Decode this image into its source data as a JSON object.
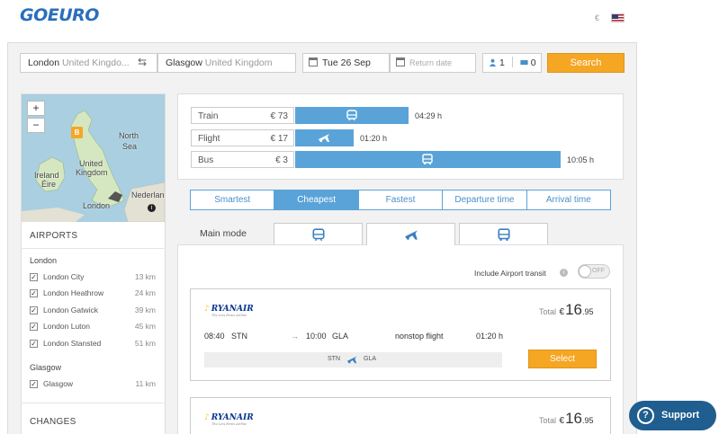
{
  "header": {
    "logo": "GOEURO",
    "currency": "€"
  },
  "search": {
    "from_city": "London",
    "from_country": "United Kingdo...",
    "to_city": "Glasgow",
    "to_country": "United Kingdom",
    "depart_date": "Tue 26 Sep",
    "return_placeholder": "Return date",
    "passengers": "1",
    "discount_cards": "0",
    "search_label": "Search"
  },
  "map": {
    "zoom_in": "+",
    "zoom_out": "−",
    "labels": [
      "North",
      "Sea",
      "United",
      "Kingdom",
      "Ireland",
      "Éire",
      "Nederland",
      "London"
    ],
    "pin_label": "B"
  },
  "sidebar": {
    "airports_title": "AIRPORTS",
    "groups": [
      {
        "name": "London",
        "airports": [
          {
            "name": "London City",
            "distance": "13 km",
            "checked": "✓"
          },
          {
            "name": "London Heathrow",
            "distance": "24 km",
            "checked": "✓"
          },
          {
            "name": "London Gatwick",
            "distance": "39 km",
            "checked": "✓"
          },
          {
            "name": "London Luton",
            "distance": "45 km",
            "checked": "✓"
          },
          {
            "name": "London Stansted",
            "distance": "51 km",
            "checked": "✓"
          }
        ]
      },
      {
        "name": "Glasgow",
        "airports": [
          {
            "name": "Glasgow",
            "distance": "11 km",
            "checked": "✓"
          }
        ]
      }
    ],
    "changes_title": "CHANGES"
  },
  "summary": {
    "modes": [
      {
        "name": "Train",
        "price": "€ 73",
        "duration": "04:29 h",
        "icon": "train-icon",
        "relative_length": 0.25
      },
      {
        "name": "Flight",
        "price": "€ 17",
        "duration": "01:20 h",
        "icon": "plane-icon",
        "relative_length": 0.13
      },
      {
        "name": "Bus",
        "price": "€ 3",
        "duration": "10:05 h",
        "icon": "bus-icon",
        "relative_length": 1.0
      }
    ],
    "bar_color": "#5aa3d8"
  },
  "sort_tabs": [
    {
      "label": "Smartest",
      "active": false
    },
    {
      "label": "Cheapest",
      "active": true
    },
    {
      "label": "Fastest",
      "active": false
    },
    {
      "label": "Departure time",
      "active": false
    },
    {
      "label": "Arrival time",
      "active": false
    }
  ],
  "main_mode": {
    "label": "Main mode",
    "tabs": [
      {
        "icon": "train-icon",
        "active": false
      },
      {
        "icon": "plane-icon",
        "active": true
      },
      {
        "icon": "bus-icon",
        "active": false
      }
    ]
  },
  "results": {
    "transit_label": "Include Airport transit",
    "toggle_state": "OFF",
    "cards": [
      {
        "airline": "RYANAIR",
        "tagline": "The Low Fares Airline",
        "total_label": "Total",
        "currency": "€",
        "price_int": "16",
        "price_dec": ".95",
        "depart_time": "08:40",
        "depart_code": "STN",
        "arrive_time": "10:00",
        "arrive_code": "GLA",
        "stops": "nonstop flight",
        "duration": "01:20 h",
        "route_from": "STN",
        "route_to": "GLA",
        "select_label": "Select"
      },
      {
        "airline": "RYANAIR",
        "tagline": "The Low Fares Airline",
        "total_label": "Total",
        "currency": "€",
        "price_int": "16",
        "price_dec": ".95"
      }
    ]
  },
  "support": {
    "label": "Support",
    "icon_text": "?"
  },
  "colors": {
    "accent_orange": "#f5a623",
    "brand_blue": "#2a6ebb",
    "tab_blue": "#5aa3d8",
    "support_blue": "#1f5e8f"
  }
}
